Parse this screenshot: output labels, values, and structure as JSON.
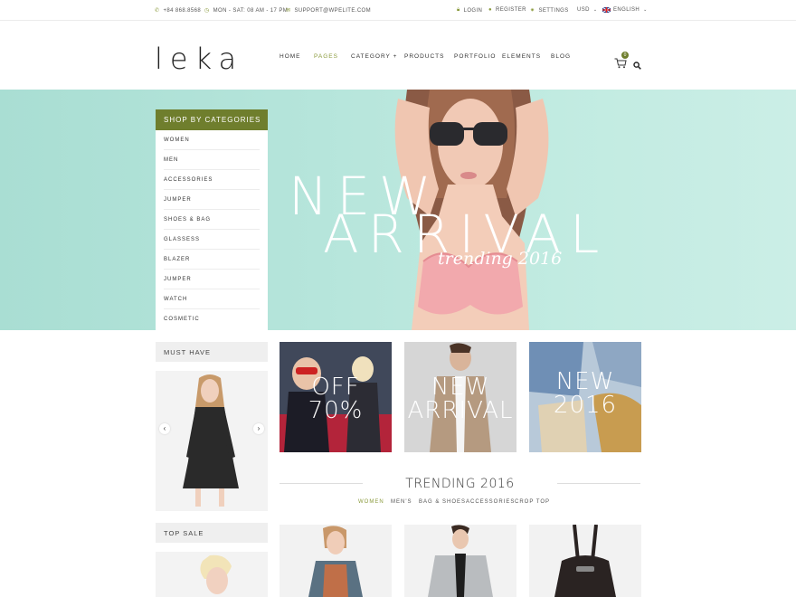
{
  "topbar": {
    "phone": "+84 868.8568",
    "hours": "MON - SAT: 08 AM - 17 PM",
    "email": "SUPPORT@WPELITE.COM",
    "login": "LOGIN",
    "register": "REGISTER",
    "settings": "SETTINGS",
    "currency": "USD",
    "language": "ENGLISH"
  },
  "header": {
    "logo": "leka",
    "nav": [
      "HOME",
      "PAGES",
      "CATEGORY +",
      "PRODUCTS",
      "PORTFOLIO",
      "ELEMENTS",
      "BLOG"
    ],
    "active_nav": "PAGES",
    "cart_count": "0"
  },
  "hero": {
    "line1": "NEW",
    "line2": "ARRIVAL",
    "subtitle": "trending 2016"
  },
  "categories": {
    "title": "SHOP BY CATEGORIES",
    "items": [
      "WOMEN",
      "MEN",
      "ACCESSORIES",
      "JUMPER",
      "SHOES & BAG",
      "GLASSESS",
      "BLAZER",
      "JUMPER",
      "WATCH",
      "COSMETIC"
    ]
  },
  "sidebar": {
    "must_have": "MUST HAVE",
    "top_sale": "TOP SALE",
    "prev": "‹",
    "next": "›"
  },
  "banners": [
    {
      "line1": "OFF",
      "line2": "70%"
    },
    {
      "line1": "NEW",
      "line2": "ARRIVAL"
    },
    {
      "line1": "NEW",
      "line2": "2016"
    }
  ],
  "trending": {
    "title": "TRENDING 2016",
    "tabs": [
      "WOMEN",
      "MEN'S",
      "BAG & SHOES",
      "ACCESSORIES",
      "CROP TOP"
    ],
    "active_tab": "WOMEN"
  },
  "colors": {
    "accent": "#6f7e2d",
    "hero_bg": "#b4e4da"
  }
}
